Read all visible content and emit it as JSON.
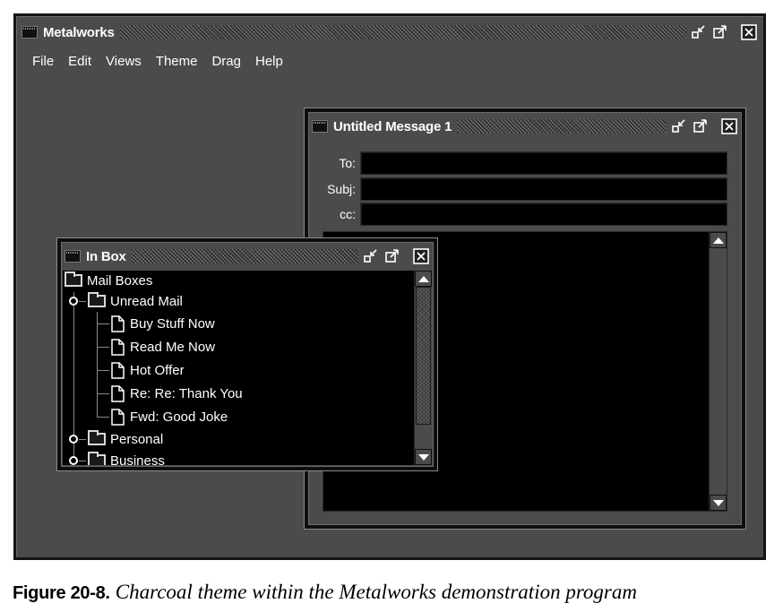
{
  "main_window": {
    "title": "Metalworks",
    "menu": [
      "File",
      "Edit",
      "Views",
      "Theme",
      "Drag",
      "Help"
    ]
  },
  "message_window": {
    "title": "Untitled Message 1",
    "fields": {
      "to_label": "To:",
      "subj_label": "Subj:",
      "cc_label": "cc:"
    }
  },
  "inbox_window": {
    "title": "In Box",
    "tree": {
      "root": "Mail Boxes",
      "unread": "Unread Mail",
      "messages": [
        "Buy Stuff Now",
        "Read Me Now",
        "Hot Offer",
        "Re: Re: Thank You",
        "Fwd: Good Joke"
      ],
      "personal": "Personal",
      "business": "Business"
    }
  },
  "caption": {
    "label": "Figure 20-8.",
    "text": "Charcoal theme within the Metalworks demonstration program"
  },
  "colors": {
    "desktop": "#4b4b4b",
    "field_bg": "#000000",
    "text": "#ffffff"
  },
  "icons": [
    "window-icon",
    "iconify-icon",
    "maximize-icon",
    "close-icon",
    "folder-icon",
    "document-icon",
    "tree-expander-icon",
    "scroll-up-icon",
    "scroll-down-icon"
  ]
}
